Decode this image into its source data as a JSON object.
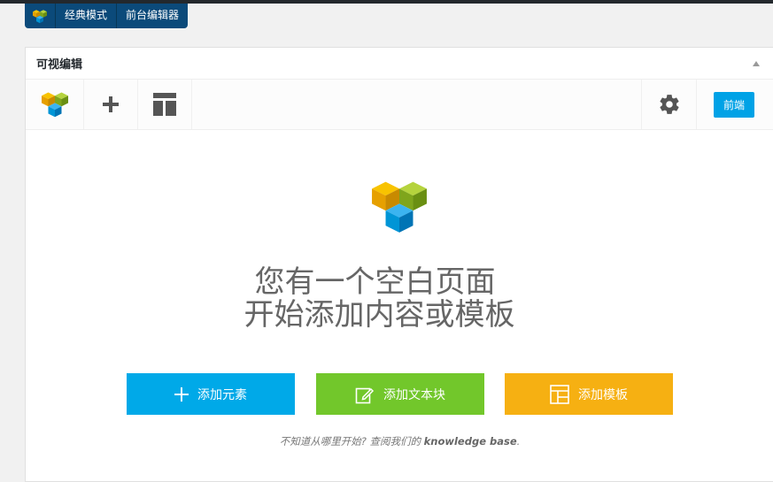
{
  "modebar": {
    "classic_label": "经典模式",
    "frontend_editor_label": "前台编辑器"
  },
  "panel": {
    "title": "可视编辑"
  },
  "toolbar": {
    "frontend_label": "前端"
  },
  "empty_state": {
    "line1": "您有一个空白页面",
    "line2": "开始添加内容或模板"
  },
  "actions": {
    "add_element": "添加元素",
    "add_text_block": "添加文本块",
    "add_template": "添加模板"
  },
  "help": {
    "prefix": "不知道从哪里开始? 查阅我们的 ",
    "link": "knowledge base",
    "suffix": "."
  },
  "colors": {
    "modebar_bg": "#0b4a7a",
    "frontend_button": "#00a2e6",
    "add_element": "#00a9e8",
    "add_text_block": "#72c72b",
    "add_template": "#f6b012"
  }
}
